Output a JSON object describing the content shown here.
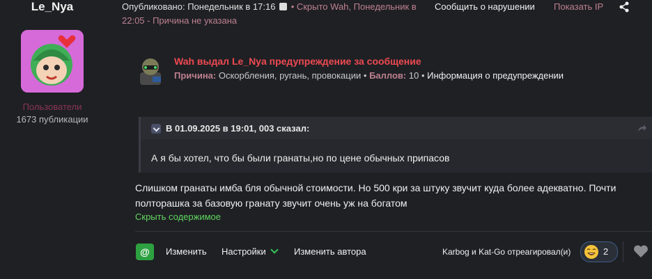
{
  "author": {
    "name": "Le_Nya",
    "group": "Пользователи",
    "posts": "1673 публикации"
  },
  "meta": {
    "published": "Опубликовано: Понедельник в 17:16",
    "hidden": "• Скрыто Wah, Понедельник в 22:05 - Причина не указана",
    "report": "Сообщить о нарушении",
    "show_ip": "Показать IP"
  },
  "warning": {
    "title": "Wah выдал Le_Nya предупреждение за сообщение",
    "reason_label": "Причина:",
    "reason": "Оскорбления, ругань, провокации",
    "points_label": "Баллов:",
    "points": "10",
    "info": "Информация о предупреждении"
  },
  "quote": {
    "by": "В 01.09.2025 в 19:01, 003 сказал:",
    "text": "А я бы хотел, что бы были гранаты,но по цене обычных припасов"
  },
  "post": {
    "text": "Слишком гранаты имба бля обычной стоимости. Но 500 кри за штуку звучит куда более адекватно. Почти полторашка за базовую гранату звучит очень уж на богатом",
    "toggle": "Скрыть содержимое"
  },
  "actions": {
    "mark": "@",
    "edit": "Изменить",
    "settings": "Настройки",
    "change_author": "Изменить автора",
    "reactions_text": "Karbog и Kat-Go отреагировал(и)",
    "reaction_count": "2"
  },
  "colors": {
    "background": "#1f2024",
    "accent_red": "#ee4a52",
    "accent_green": "#2da040",
    "muted_pink": "#bd8190"
  },
  "icons": [
    "edit-icon",
    "share-icon",
    "chevron-down-icon",
    "quote-link-icon",
    "laugh-emoji-icon",
    "heart-icon"
  ]
}
